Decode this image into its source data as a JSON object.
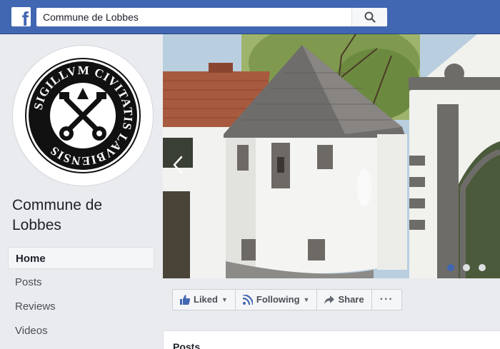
{
  "topbar": {
    "search_value": "Commune de Lobbes",
    "logo_glyph": "f",
    "brand_color": "#4267b2"
  },
  "profile": {
    "seal_text": "SIGILLVM CIVITATIS LAVBIENSIS",
    "page_name": "Commune de Lobbes"
  },
  "nav": {
    "items": [
      {
        "label": "Home",
        "active": true
      },
      {
        "label": "Posts",
        "active": false
      },
      {
        "label": "Reviews",
        "active": false
      },
      {
        "label": "Videos",
        "active": false
      }
    ]
  },
  "cover": {
    "prev_icon": "chevron-left-icon",
    "slides": 3,
    "active_slide": 1
  },
  "actions": {
    "liked": "Liked",
    "following": "Following",
    "share": "Share",
    "more": "···"
  },
  "posts": {
    "title": "Posts"
  }
}
